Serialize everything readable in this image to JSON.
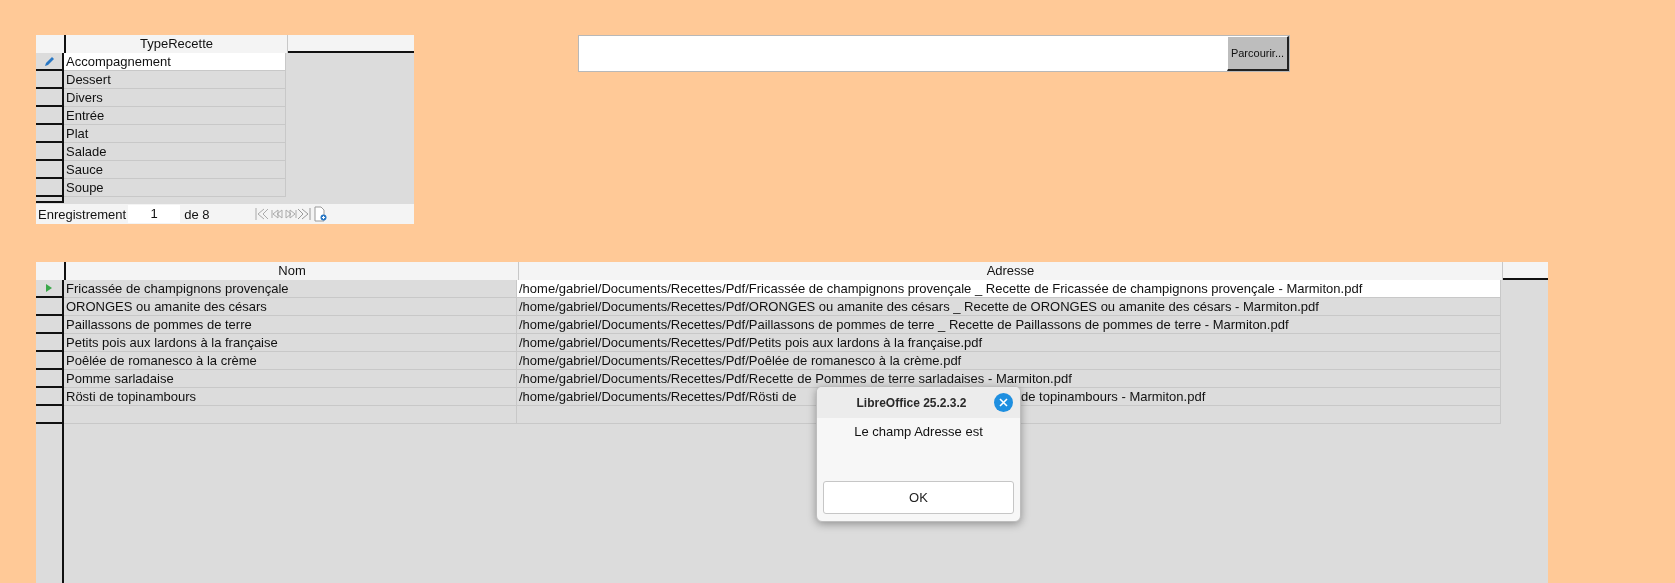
{
  "type_grid": {
    "column": "TypeRecette",
    "rows": [
      {
        "value": "Accompagnement",
        "selected": true
      },
      {
        "value": "Dessert",
        "selected": false
      },
      {
        "value": "Divers",
        "selected": false
      },
      {
        "value": "Entrée",
        "selected": false
      },
      {
        "value": "Plat",
        "selected": false
      },
      {
        "value": "Salade",
        "selected": false
      },
      {
        "value": "Sauce",
        "selected": false
      },
      {
        "value": "Soupe",
        "selected": false
      }
    ],
    "navigation": {
      "label": "Enregistrement",
      "record": "1",
      "of": "de 8"
    }
  },
  "file_picker": {
    "button": "Parcourir..."
  },
  "recipe_grid": {
    "columns": [
      "Nom",
      "Adresse"
    ],
    "rows": [
      {
        "name": "Fricassée de champignons provençale",
        "address": [
          "/home/gabriel/Documents/Recettes/Pdf/Fricassée de champignons provençale _ Recette de Fricassée de champignons provençale - Marmiton.pdf"
        ],
        "selected": true
      },
      {
        "name": "ORONGES ou amanite des césars",
        "address": [
          "/home/gabriel/Documents/Recettes/Pdf/ORONGES ou amanite des césars _ Recette de ORONGES ou amanite des césars - Marmiton.pdf"
        ],
        "selected": false
      },
      {
        "name": "Paillassons de pommes de terre",
        "address": [
          "/home/gabriel/Documents/Recettes/Pdf/Paillassons de pommes de terre _ Recette de Paillassons de pommes de terre - Marmiton.pdf"
        ],
        "selected": false
      },
      {
        "name": "Petits pois aux lardons à la française",
        "address": [
          "/home/gabriel/Documents/Recettes/Pdf/Petits pois aux lardons à la française.pdf"
        ],
        "selected": false
      },
      {
        "name": "Poêlée de romanesco à la crème",
        "address": [
          "/home/gabriel/Documents/Recettes/Pdf/Poêlée de romanesco à la crème.pdf"
        ],
        "selected": false
      },
      {
        "name": "Pomme sarladaise",
        "address": [
          "/home/gabriel/Documents/Recettes/Pdf/Recette de Pommes de terre sarladaises - Marmiton.pdf"
        ],
        "selected": false
      },
      {
        "name": "Rösti de topinambours",
        "address": [
          "/home/gabriel/Documents/Recettes/Pdf/Rösti de",
          "de topinambours - Marmiton.pdf"
        ],
        "selected": false
      }
    ]
  },
  "dialog": {
    "title": "LibreOffice 25.2.3.2",
    "message": "Le champ Adresse est",
    "button": "OK"
  }
}
